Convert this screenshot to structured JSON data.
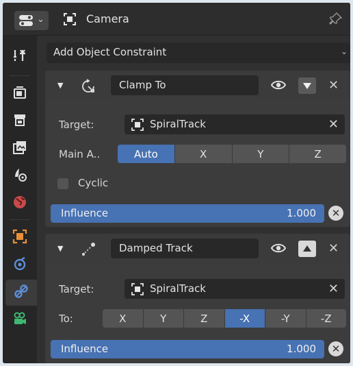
{
  "header": {
    "title": "Camera"
  },
  "add_constraint": {
    "label": "Add Object Constraint"
  },
  "constraints": [
    {
      "name": "Clamp To",
      "target_label": "Target:",
      "target_value": "SpiralTrack",
      "main_axis_label": "Main A..",
      "main_axis_options": [
        "Auto",
        "X",
        "Y",
        "Z"
      ],
      "main_axis_selected": "Auto",
      "cyclic_label": "Cyclic",
      "cyclic_checked": false,
      "influence_label": "Influence",
      "influence_value": "1.000"
    },
    {
      "name": "Damped Track",
      "target_label": "Target:",
      "target_value": "SpiralTrack",
      "to_label": "To:",
      "to_options": [
        "X",
        "Y",
        "Z",
        "-X",
        "-Y",
        "-Z"
      ],
      "to_selected": "-X",
      "influence_label": "Influence",
      "influence_value": "1.000"
    }
  ],
  "sidebar": {
    "tabs": [
      "tool-icon",
      "render-icon",
      "output-icon",
      "view-layer-icon",
      "scene-icon",
      "world-icon",
      "object-icon",
      "modifier-icon",
      "constraint-icon",
      "camera-data-icon"
    ],
    "active": "constraint-icon"
  },
  "colors": {
    "accent": "#4772b3",
    "panel": "#3c3c3c",
    "background": "#303030"
  }
}
